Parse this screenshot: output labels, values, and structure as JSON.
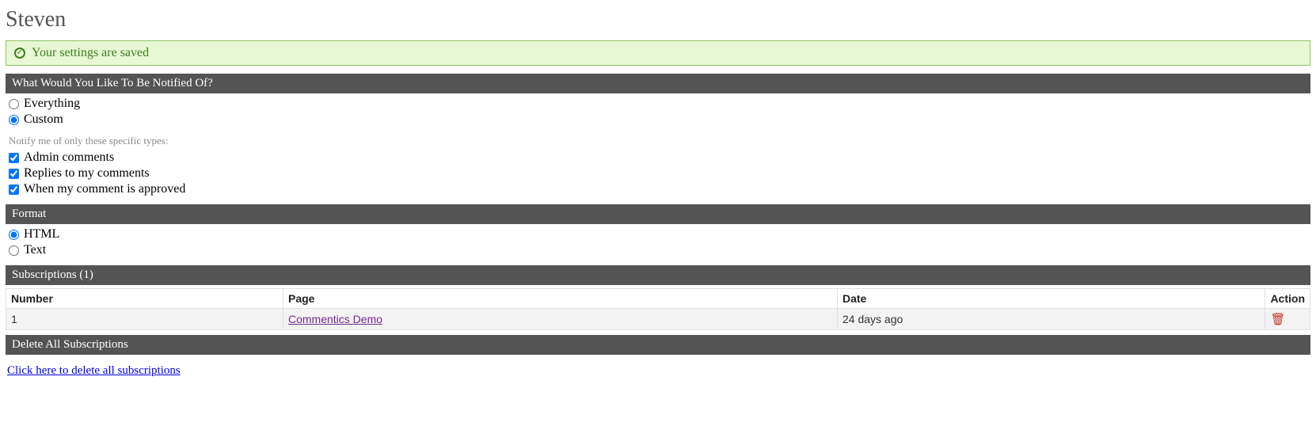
{
  "page_title": "Steven",
  "alert": {
    "message": "Your settings are saved"
  },
  "sections": {
    "notify_header": "What Would You Like To Be Notified Of?",
    "format_header": "Format",
    "subscriptions_header": "Subscriptions (1)",
    "delete_header": "Delete All Subscriptions"
  },
  "notify": {
    "options": {
      "everything": "Everything",
      "custom": "Custom"
    },
    "selected": "custom",
    "hint": "Notify me of only these specific types:",
    "types": {
      "admin_comments": {
        "label": "Admin comments",
        "checked": true
      },
      "replies": {
        "label": "Replies to my comments",
        "checked": true
      },
      "approved": {
        "label": "When my comment is approved",
        "checked": true
      }
    }
  },
  "format": {
    "options": {
      "html": "HTML",
      "text": "Text"
    },
    "selected": "html"
  },
  "subscriptions": {
    "columns": {
      "number": "Number",
      "page": "Page",
      "date": "Date",
      "action": "Action"
    },
    "rows": [
      {
        "number": "1",
        "page": "Commentics Demo",
        "date": "24 days ago"
      }
    ]
  },
  "delete_all_link": "Click here to delete all subscriptions"
}
